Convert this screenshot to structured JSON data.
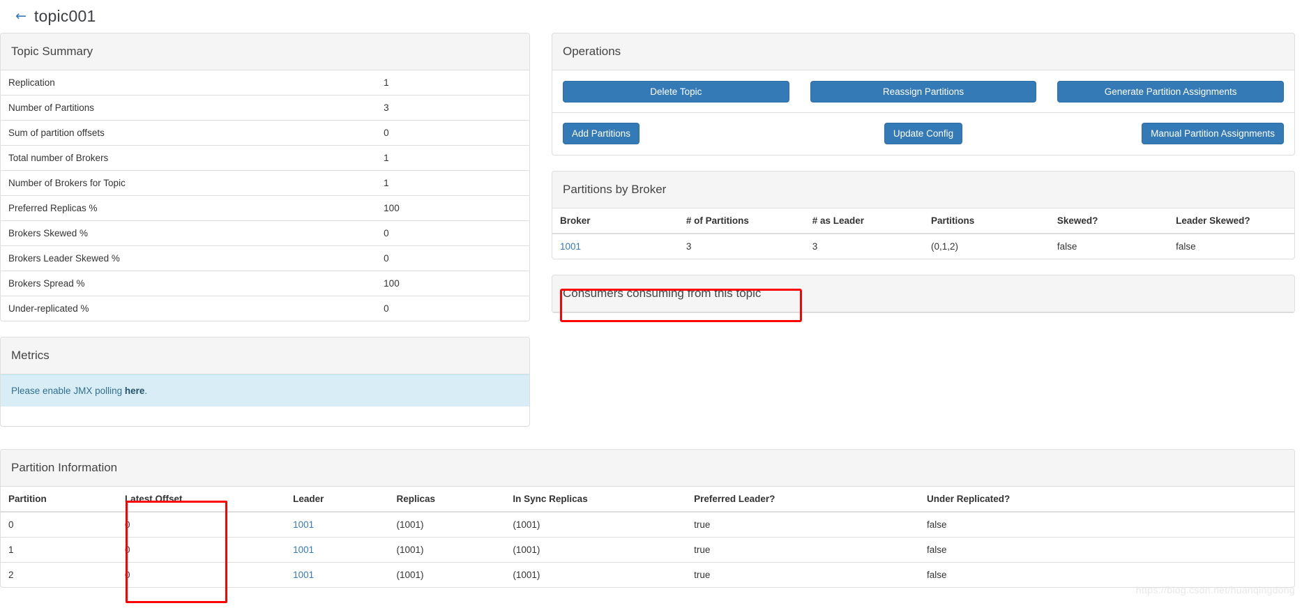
{
  "header": {
    "back_icon": "arrow-left-icon",
    "title": "topic001"
  },
  "topic_summary": {
    "title": "Topic Summary",
    "rows": [
      {
        "label": "Replication",
        "value": "1"
      },
      {
        "label": "Number of Partitions",
        "value": "3"
      },
      {
        "label": "Sum of partition offsets",
        "value": "0"
      },
      {
        "label": "Total number of Brokers",
        "value": "1"
      },
      {
        "label": "Number of Brokers for Topic",
        "value": "1"
      },
      {
        "label": "Preferred Replicas %",
        "value": "100"
      },
      {
        "label": "Brokers Skewed %",
        "value": "0"
      },
      {
        "label": "Brokers Leader Skewed %",
        "value": "0"
      },
      {
        "label": "Brokers Spread %",
        "value": "100"
      },
      {
        "label": "Under-replicated %",
        "value": "0"
      }
    ]
  },
  "metrics": {
    "title": "Metrics",
    "alert_prefix": "Please enable JMX polling ",
    "alert_link": "here",
    "alert_suffix": "."
  },
  "operations": {
    "title": "Operations",
    "row1": [
      {
        "label": "Delete Topic",
        "name": "delete-topic-button"
      },
      {
        "label": "Reassign Partitions",
        "name": "reassign-partitions-button"
      },
      {
        "label": "Generate Partition Assignments",
        "name": "generate-partition-assignments-button"
      }
    ],
    "row2": [
      {
        "label": "Add Partitions",
        "name": "add-partitions-button"
      },
      {
        "label": "Update Config",
        "name": "update-config-button"
      },
      {
        "label": "Manual Partition Assignments",
        "name": "manual-partition-assignments-button"
      }
    ]
  },
  "partitions_by_broker": {
    "title": "Partitions by Broker",
    "columns": [
      "Broker",
      "# of Partitions",
      "# as Leader",
      "Partitions",
      "Skewed?",
      "Leader Skewed?"
    ],
    "rows": [
      {
        "broker": "1001",
        "num_partitions": "3",
        "num_as_leader": "3",
        "partitions": "(0,1,2)",
        "skewed": "false",
        "leader_skewed": "false"
      }
    ]
  },
  "consumers": {
    "title": "Consumers consuming from this topic"
  },
  "partition_information": {
    "title": "Partition Information",
    "columns": [
      "Partition",
      "Latest Offset",
      "Leader",
      "Replicas",
      "In Sync Replicas",
      "Preferred Leader?",
      "Under Replicated?"
    ],
    "rows": [
      {
        "partition": "0",
        "latest_offset": "0",
        "leader": "1001",
        "replicas": "(1001)",
        "isr": "(1001)",
        "preferred_leader": "true",
        "under_replicated": "false"
      },
      {
        "partition": "1",
        "latest_offset": "0",
        "leader": "1001",
        "replicas": "(1001)",
        "isr": "(1001)",
        "preferred_leader": "true",
        "under_replicated": "false"
      },
      {
        "partition": "2",
        "latest_offset": "0",
        "leader": "1001",
        "replicas": "(1001)",
        "isr": "(1001)",
        "preferred_leader": "true",
        "under_replicated": "false"
      }
    ]
  },
  "watermark": {
    "text": "https://blog.csdn.net/huanqingdong"
  },
  "colors": {
    "primary": "#337ab7",
    "panel_heading_bg": "#f5f5f5",
    "border": "#dddddd",
    "annotation": "#ff0000",
    "alert_info_bg": "#d9edf7"
  }
}
